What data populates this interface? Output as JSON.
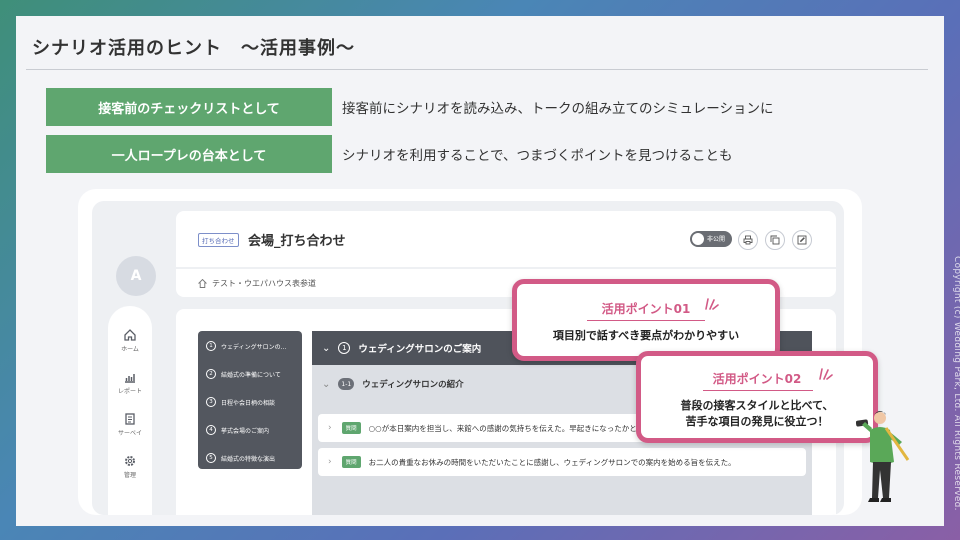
{
  "page": {
    "title": "シナリオ活用のヒント　～活用事例～",
    "copyright": "Copyright (c) Wedding Park, Ltd. All Rights Reserved."
  },
  "hints": [
    {
      "label": "接客前のチェックリストとして",
      "text": "接客前にシナリオを読み込み、トークの組み立てのシミュレーションに"
    },
    {
      "label": "一人ロープレの台本として",
      "text": "シナリオを利用することで、つまづくポイントを見つけることも"
    }
  ],
  "mock": {
    "avatar": "A",
    "nav": [
      {
        "label": "ホーム",
        "icon": "home-icon"
      },
      {
        "label": "レポート",
        "icon": "report-icon"
      },
      {
        "label": "サーベイ",
        "icon": "survey-icon"
      },
      {
        "label": "管理",
        "icon": "gear-icon"
      }
    ],
    "tag": "打ち合わせ",
    "title": "会場_打ち合わせ",
    "toggle_label": "非公開",
    "store": "テスト・ウエパハウス表参道",
    "toc": [
      {
        "num": "1",
        "label": "ウェディングサロンの..."
      },
      {
        "num": "2",
        "label": "結婚式の準備について"
      },
      {
        "num": "3",
        "label": "日程や会日柄の相談"
      },
      {
        "num": "4",
        "label": "挙式会場のご案内"
      },
      {
        "num": "5",
        "label": "結婚式の特徴な演出"
      }
    ],
    "section": {
      "num": "1",
      "title": "ウェディングサロンのご案内"
    },
    "subsection": {
      "num": "1-1",
      "title": "ウェディングサロンの紹介"
    },
    "items": [
      {
        "badge": "質問",
        "text": "○○が本日案内を担当し、来館への感謝の気持ちを伝えた。早起きになったかと"
      },
      {
        "badge": "質問",
        "text": "お二人の貴重なお休みの時間をいただいたことに感謝し、ウェディングサロンでの案内を始める旨を伝えた。"
      }
    ]
  },
  "callouts": [
    {
      "title": "活用ポイント01",
      "text": "項目別で話すべき要点がわかりやすい"
    },
    {
      "title": "活用ポイント02",
      "line1": "普段の接客スタイルと比べて、",
      "line2": "苦手な項目の発見に役立つ！"
    }
  ],
  "colors": {
    "accent_green": "#5fa66f",
    "accent_pink": "#d25a86",
    "dark_gray": "#53575f"
  }
}
